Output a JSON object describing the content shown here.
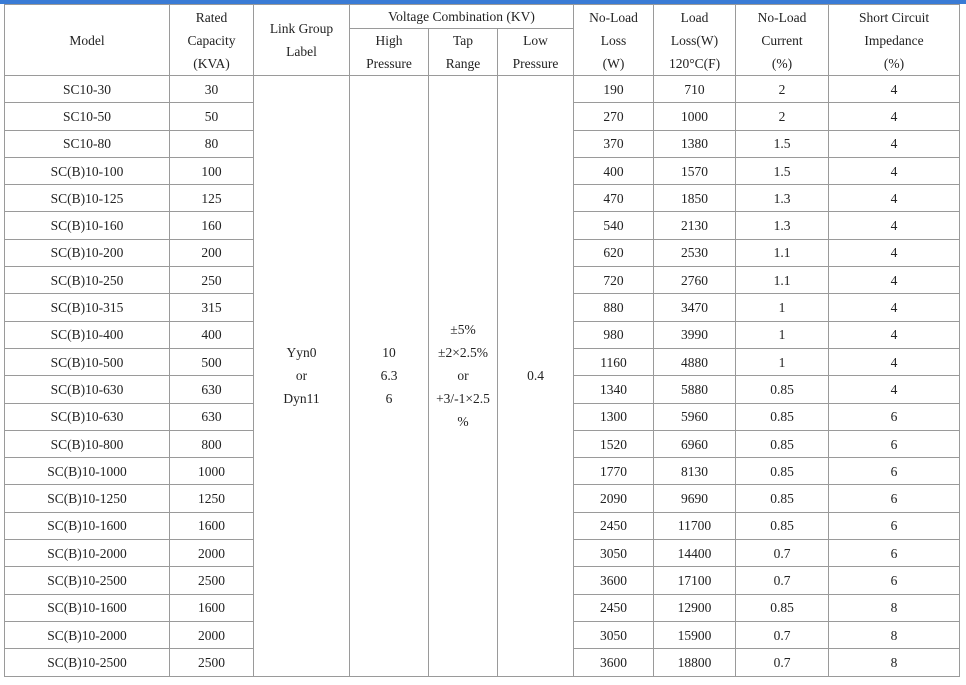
{
  "accent_color": "#3a7bd5",
  "headers": {
    "model": "Model",
    "rated_capacity": [
      "Rated",
      "Capacity",
      "(KVA)"
    ],
    "link_group": [
      "Link Group",
      "Label"
    ],
    "voltage_combination": "Voltage Combination (KV)",
    "high_pressure": [
      "High",
      "Pressure"
    ],
    "tap_range": [
      "Tap",
      "Range"
    ],
    "low_pressure": [
      "Low",
      "Pressure"
    ],
    "no_load_loss": [
      "No-Load",
      "Loss",
      "(W)"
    ],
    "load_loss": [
      "Load",
      "Loss(W)",
      "120°C(F)"
    ],
    "no_load_current": [
      "No-Load",
      "Current",
      "(%)"
    ],
    "short_circuit": [
      "Short Circuit",
      "Impedance",
      "(%)"
    ]
  },
  "merged": {
    "link_group": [
      "Yyn0",
      "or",
      "Dyn11"
    ],
    "high_pressure": [
      "10",
      "6.3",
      "6"
    ],
    "tap_range": [
      "±5%",
      "±2×2.5%",
      "or",
      "+3/-1×2.5",
      "%"
    ],
    "low_pressure": "0.4"
  },
  "rows": [
    {
      "model": "SC10-30",
      "capacity": "30",
      "no_load_loss": "190",
      "load_loss": "710",
      "current": "2",
      "impedance": "4"
    },
    {
      "model": "SC10-50",
      "capacity": "50",
      "no_load_loss": "270",
      "load_loss": "1000",
      "current": "2",
      "impedance": "4"
    },
    {
      "model": "SC10-80",
      "capacity": "80",
      "no_load_loss": "370",
      "load_loss": "1380",
      "current": "1.5",
      "impedance": "4"
    },
    {
      "model": "SC(B)10-100",
      "capacity": "100",
      "no_load_loss": "400",
      "load_loss": "1570",
      "current": "1.5",
      "impedance": "4"
    },
    {
      "model": "SC(B)10-125",
      "capacity": "125",
      "no_load_loss": "470",
      "load_loss": "1850",
      "current": "1.3",
      "impedance": "4"
    },
    {
      "model": "SC(B)10-160",
      "capacity": "160",
      "no_load_loss": "540",
      "load_loss": "2130",
      "current": "1.3",
      "impedance": "4"
    },
    {
      "model": "SC(B)10-200",
      "capacity": "200",
      "no_load_loss": "620",
      "load_loss": "2530",
      "current": "1.1",
      "impedance": "4"
    },
    {
      "model": "SC(B)10-250",
      "capacity": "250",
      "no_load_loss": "720",
      "load_loss": "2760",
      "current": "1.1",
      "impedance": "4"
    },
    {
      "model": "SC(B)10-315",
      "capacity": "315",
      "no_load_loss": "880",
      "load_loss": "3470",
      "current": "1",
      "impedance": "4"
    },
    {
      "model": "SC(B)10-400",
      "capacity": "400",
      "no_load_loss": "980",
      "load_loss": "3990",
      "current": "1",
      "impedance": "4"
    },
    {
      "model": "SC(B)10-500",
      "capacity": "500",
      "no_load_loss": "1160",
      "load_loss": "4880",
      "current": "1",
      "impedance": "4"
    },
    {
      "model": "SC(B)10-630",
      "capacity": "630",
      "no_load_loss": "1340",
      "load_loss": "5880",
      "current": "0.85",
      "impedance": "4"
    },
    {
      "model": "SC(B)10-630",
      "capacity": "630",
      "no_load_loss": "1300",
      "load_loss": "5960",
      "current": "0.85",
      "impedance": "6"
    },
    {
      "model": "SC(B)10-800",
      "capacity": "800",
      "no_load_loss": "1520",
      "load_loss": "6960",
      "current": "0.85",
      "impedance": "6"
    },
    {
      "model": "SC(B)10-1000",
      "capacity": "1000",
      "no_load_loss": "1770",
      "load_loss": "8130",
      "current": "0.85",
      "impedance": "6"
    },
    {
      "model": "SC(B)10-1250",
      "capacity": "1250",
      "no_load_loss": "2090",
      "load_loss": "9690",
      "current": "0.85",
      "impedance": "6"
    },
    {
      "model": "SC(B)10-1600",
      "capacity": "1600",
      "no_load_loss": "2450",
      "load_loss": "11700",
      "current": "0.85",
      "impedance": "6"
    },
    {
      "model": "SC(B)10-2000",
      "capacity": "2000",
      "no_load_loss": "3050",
      "load_loss": "14400",
      "current": "0.7",
      "impedance": "6"
    },
    {
      "model": "SC(B)10-2500",
      "capacity": "2500",
      "no_load_loss": "3600",
      "load_loss": "17100",
      "current": "0.7",
      "impedance": "6"
    },
    {
      "model": "SC(B)10-1600",
      "capacity": "1600",
      "no_load_loss": "2450",
      "load_loss": "12900",
      "current": "0.85",
      "impedance": "8"
    },
    {
      "model": "SC(B)10-2000",
      "capacity": "2000",
      "no_load_loss": "3050",
      "load_loss": "15900",
      "current": "0.7",
      "impedance": "8"
    },
    {
      "model": "SC(B)10-2500",
      "capacity": "2500",
      "no_load_loss": "3600",
      "load_loss": "18800",
      "current": "0.7",
      "impedance": "8"
    }
  ]
}
